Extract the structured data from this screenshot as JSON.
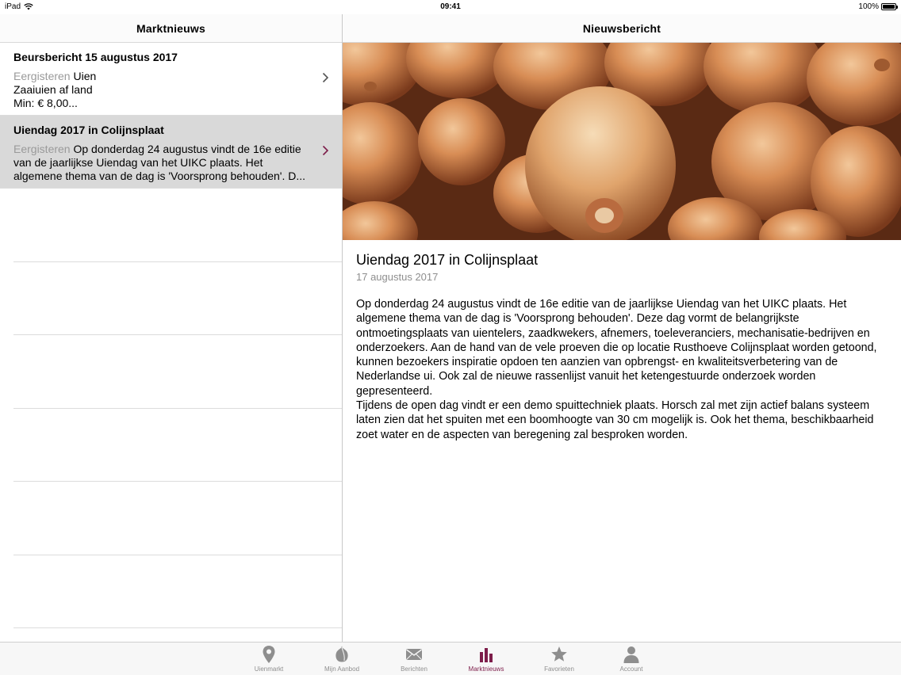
{
  "status": {
    "device": "iPad",
    "time": "09:41",
    "battery": "100%"
  },
  "master": {
    "title": "Marktnieuws",
    "items": [
      {
        "title": "Beursbericht 15 augustus 2017",
        "when": "Eergisteren",
        "preview_first": "Uien",
        "preview_rest": "Zaaiuien af land\nMin: € 8,00..."
      },
      {
        "title": "Uiendag 2017 in Colijnsplaat",
        "when": "Eergisteren",
        "preview_first": "Op donderdag 24 augustus vindt de 16e editie",
        "preview_rest": "van de jaarlijkse Uiendag van het UIKC plaats. Het algemene thema van de dag is 'Voorsprong behouden'. D..."
      }
    ]
  },
  "detail": {
    "header": "Nieuwsbericht",
    "title": "Uiendag 2017 in Colijnsplaat",
    "date": "17 augustus 2017",
    "body": "Op donderdag 24 augustus vindt de 16e editie van de jaarlijkse Uiendag van het UIKC plaats. Het algemene thema van de dag is 'Voorsprong behouden'. Deze dag vormt de belangrijkste ontmoetingsplaats van uientelers, zaadkwekers, afnemers, toeleveranciers, mechanisatie-bedrijven en onderzoekers. Aan de hand van de vele proeven die op locatie Rusthoeve Colijnsplaat worden getoond, kunnen bezoekers inspiratie opdoen ten aanzien van opbrengst- en kwaliteitsverbetering van de Nederlandse ui. Ook zal de nieuwe rassenlijst vanuit het ketengestuurde onderzoek worden gepresenteerd.\nTijdens de open dag vindt er een demo spuittechniek plaats. Horsch zal met zijn actief balans systeem laten zien dat het spuiten met een boomhoogte van 30 cm mogelijk is. Ook het thema, beschikbaarheid zoet water en de aspecten van beregening zal besproken worden."
  },
  "tabs": [
    {
      "label": "Uienmarkt",
      "icon": "map-pin-icon"
    },
    {
      "label": "Mijn Aanbod",
      "icon": "onion-icon"
    },
    {
      "label": "Berichten",
      "icon": "envelope-icon"
    },
    {
      "label": "Marktnieuws",
      "icon": "bar-chart-icon",
      "active": true
    },
    {
      "label": "Favorieten",
      "icon": "star-icon"
    },
    {
      "label": "Account",
      "icon": "person-icon"
    }
  ],
  "colors": {
    "accent": "#7d1d4a",
    "selected_row": "#d9d9d9"
  }
}
